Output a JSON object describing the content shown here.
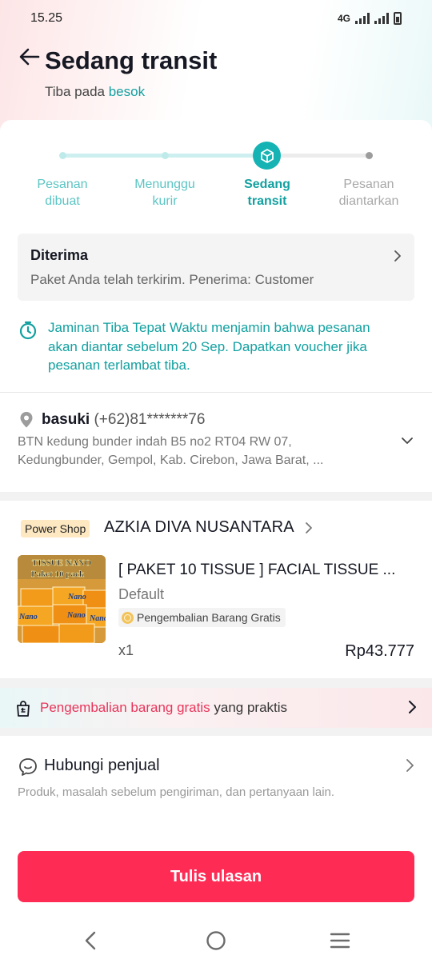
{
  "status_bar": {
    "time": "15.25",
    "network": "4G"
  },
  "header": {
    "title": "Sedang transit",
    "subtitle_prefix": "Tiba pada",
    "subtitle_highlight": "besok"
  },
  "progress": {
    "steps": [
      {
        "line1": "Pesanan",
        "line2": "dibuat",
        "state": "done"
      },
      {
        "line1": "Menunggu",
        "line2": "kurir",
        "state": "done"
      },
      {
        "line1": "Sedang",
        "line2": "transit",
        "state": "current"
      },
      {
        "line1": "Pesanan",
        "line2": "diantarkan",
        "state": "todo"
      }
    ]
  },
  "received": {
    "title": "Diterima",
    "description": "Paket Anda telah terkirim. Penerima: Customer"
  },
  "guarantee": {
    "line1": "Jaminan Tiba Tepat Waktu menjamin bahwa pesanan",
    "line2": "akan diantar sebelum 20 Sep. Dapatkan voucher jika",
    "line3": "pesanan terlambat tiba."
  },
  "address": {
    "name": "basuki",
    "phone": "(+62)81*******76",
    "line1": "BTN kedung bunder indah B5 no2 RT04 RW 07,",
    "line2": "Kedungbunder, Gempol, Kab. Cirebon, Jawa Barat, ..."
  },
  "shop": {
    "badge": "Power Shop",
    "name": "AZKIA DIVA NUSANTARA"
  },
  "product": {
    "image_text_1": "TISSUE NANO",
    "image_text_2": "Paket 10 pack",
    "image_brand": "Nano",
    "title": "[ PAKET 10 TISSUE ] FACIAL TISSUE ...",
    "variant": "Default",
    "tag": "Pengembalian Barang Gratis",
    "quantity": "x1",
    "price": "Rp43.777"
  },
  "return_banner": {
    "highlight": "Pengembalian barang gratis",
    "rest": "yang praktis"
  },
  "contact": {
    "title": "Hubungi penjual",
    "description": "Produk, masalah sebelum pengiriman, dan pertanyaan lain."
  },
  "review_button": {
    "label": "Tulis ulasan"
  },
  "colors": {
    "accent_teal": "#13a0a0",
    "primary_red": "#fe2c55",
    "return_red": "#e8355a"
  }
}
